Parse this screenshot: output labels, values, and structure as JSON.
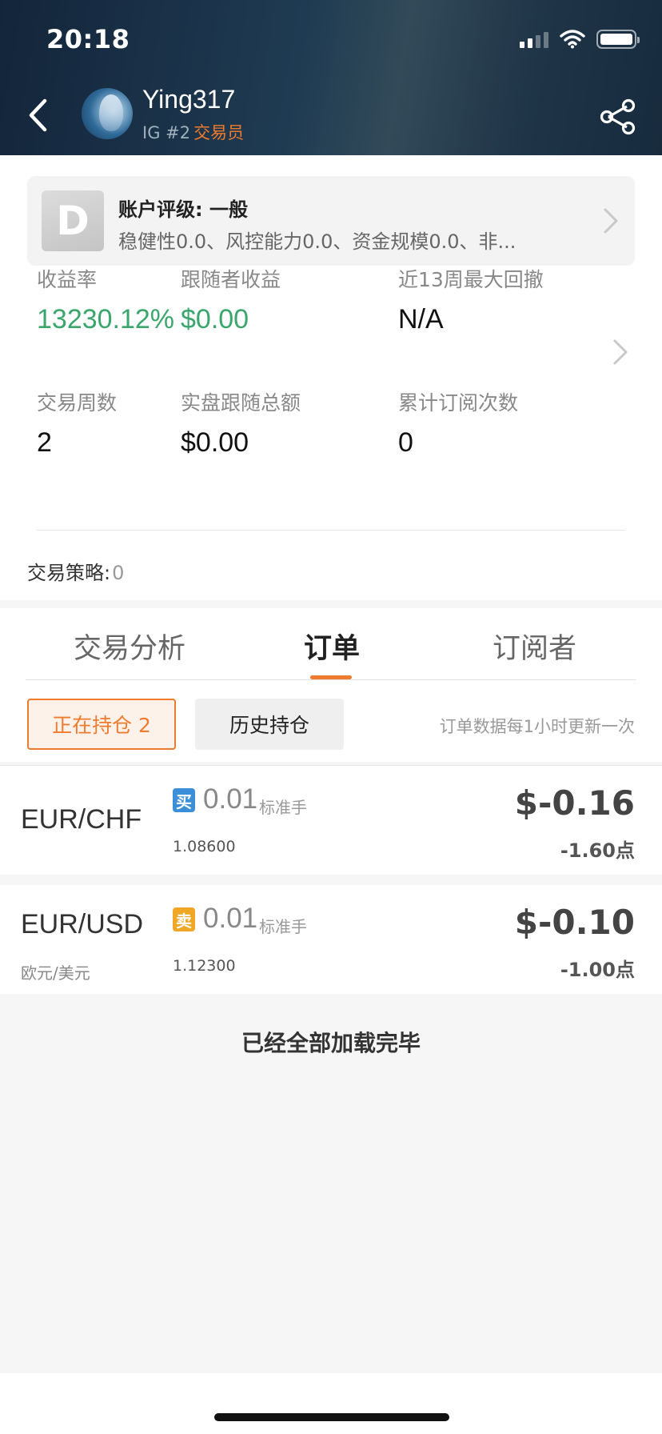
{
  "status_bar": {
    "time": "20:18"
  },
  "header": {
    "user_name": "Ying317",
    "broker_rank": "IG #2",
    "role": "交易员"
  },
  "rating": {
    "grade": "D",
    "title": "账户评级: 一般",
    "description": "稳健性0.0、风控能力0.0、资金规模0.0、非..."
  },
  "stats": {
    "return_label": "收益率",
    "return_value": "13230.12%",
    "follower_profit_label": "跟随者收益",
    "follower_profit_value": "$0.00",
    "max_drawdown_label": "近13周最大回撤",
    "max_drawdown_value": "N/A",
    "weeks_label": "交易周数",
    "weeks_value": "2",
    "live_follow_label": "实盘跟随总额",
    "live_follow_value": "$0.00",
    "subscriptions_label": "累计订阅次数",
    "subscriptions_value": "0"
  },
  "strategy": {
    "label": "交易策略:",
    "count": "0"
  },
  "tabs": [
    {
      "label": "交易分析",
      "active": false
    },
    {
      "label": "订单",
      "active": true
    },
    {
      "label": "订阅者",
      "active": false
    }
  ],
  "filters": {
    "open_positions": "正在持仓 2",
    "history": "历史持仓",
    "note": "订单数据每1小时更新一次"
  },
  "orders": [
    {
      "symbol": "EUR/CHF",
      "symbol_cn": "",
      "side": "买",
      "lot": "0.01",
      "lot_unit": "标准手",
      "price": "1.08600",
      "pnl": "$-0.16",
      "points": "-1.60点"
    },
    {
      "symbol": "EUR/USD",
      "symbol_cn": "欧元/美元",
      "side": "卖",
      "lot": "0.01",
      "lot_unit": "标准手",
      "price": "1.12300",
      "pnl": "$-0.10",
      "points": "-1.00点"
    }
  ],
  "footer": {
    "loaded_message": "已经全部加载完毕"
  },
  "colors": {
    "accent_orange": "#f07a2e",
    "positive_green": "#3aa66b",
    "buy_blue": "#3b8fd9",
    "sell_yellow": "#f0a726",
    "header_dark": "#172b3e"
  }
}
